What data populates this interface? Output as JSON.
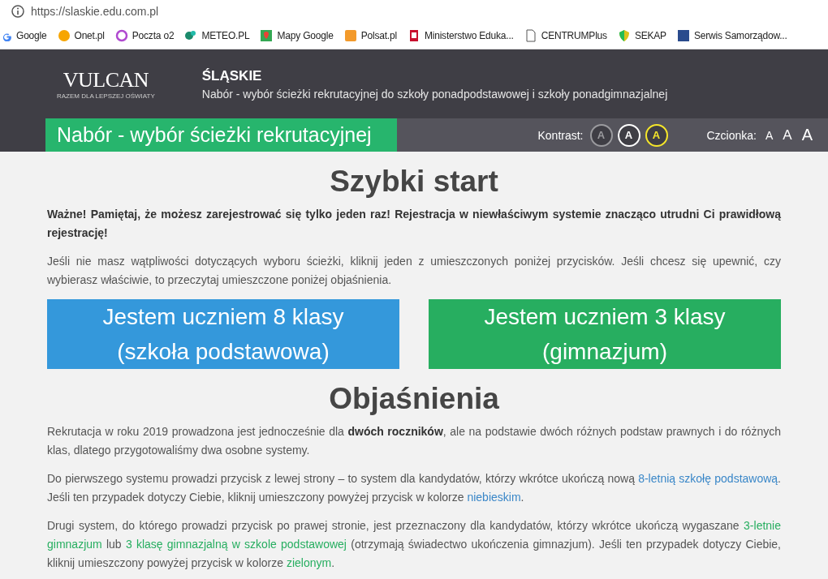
{
  "browser": {
    "url": "https://slaskie.edu.com.pl",
    "bookmarks": [
      "Google",
      "Onet.pl",
      "Poczta o2",
      "METEO.PL",
      "Mapy Google",
      "Polsat.pl",
      "Ministerstwo Eduka...",
      "CENTRUMPlus",
      "SEKAP",
      "Serwis Samorządow..."
    ]
  },
  "header": {
    "logo": "VULCAN",
    "logo_tagline": "RAZEM DLA LEPSZEJ OŚWIATY",
    "region": "ŚLĄSKIE",
    "subtitle": "Nabór - wybór ścieżki rekrutacyjnej do szkoły ponadpodstawowej i szkoły ponadgimnazjalnej",
    "page_title": "Nabór - wybór ścieżki rekrutacyjnej",
    "contrast_label": "Kontrast:",
    "contrast_options": [
      {
        "label": "A",
        "color": "#9a9a9e"
      },
      {
        "label": "A",
        "color": "#ffffff"
      },
      {
        "label": "A",
        "color": "#f5e62a"
      }
    ],
    "font_label": "Czcionka:",
    "font_options": [
      {
        "label": "A",
        "kind": "small"
      },
      {
        "label": "A",
        "kind": "medium"
      },
      {
        "label": "A",
        "kind": "large"
      }
    ]
  },
  "quick_start": {
    "heading": "Szybki start",
    "warning": "Ważne! Pamiętaj, że możesz zarejestrować się tylko jeden raz! Rejestracja w niewłaściwym systemie znacząco utrudni Ci prawidłową rejestrację!",
    "intro": "Jeśli nie masz wątpliwości dotyczących wyboru ścieżki, kliknij jeden z umieszczonych poniżej przycisków. Jeśli chcesz się upewnić, czy wybierasz właściwie, to przeczytaj umieszczone poniżej objaśnienia.",
    "buttons": [
      {
        "line1": "Jestem uczniem 8 klasy",
        "line2": "(szkoła podstawowa)",
        "color": "#3498db"
      },
      {
        "line1": "Jestem uczniem 3 klasy",
        "line2": "(gimnazjum)",
        "color": "#27ae60"
      }
    ]
  },
  "explanations": {
    "heading": "Objaśnienia",
    "paragraphs": [
      [
        {
          "text": "Rekrutacja w roku 2019 prowadzona jest jednocześnie dla "
        },
        {
          "text": "dwóch roczników",
          "kind": "bold"
        },
        {
          "text": ", ale na podstawie dwóch różnych podstaw prawnych i do różnych klas, dlatego przygotowaliśmy dwa osobne systemy."
        }
      ],
      [
        {
          "text": "Do pierwszego systemu prowadzi przycisk z lewej strony – to system dla kandydatów, którzy wkrótce ukończą nową "
        },
        {
          "text": "8-letnią szkołę podstawową",
          "kind": "colored",
          "color": "#3a87c8"
        },
        {
          "text": ". Jeśli ten przypadek dotyczy Ciebie, kliknij umieszczony powyżej przycisk w kolorze "
        },
        {
          "text": "niebieskim",
          "kind": "colored",
          "color": "#3a87c8"
        },
        {
          "text": "."
        }
      ],
      [
        {
          "text": "Drugi system, do którego prowadzi przycisk po prawej stronie, jest przeznaczony dla kandydatów, którzy wkrótce ukończą wygaszane "
        },
        {
          "text": "3-letnie gimnazjum",
          "kind": "colored",
          "color": "#27ae60"
        },
        {
          "text": " lub "
        },
        {
          "text": "3 klasę gimnazjalną w szkole podstawowej",
          "kind": "colored",
          "color": "#27ae60"
        },
        {
          "text": " (otrzymają świadectwo ukończenia gimnazjum). Jeśli ten przypadek dotyczy Ciebie, kliknij umieszczony powyżej przycisk w kolorze "
        },
        {
          "text": "zielonym",
          "kind": "colored",
          "color": "#27ae60"
        },
        {
          "text": "."
        }
      ]
    ]
  }
}
